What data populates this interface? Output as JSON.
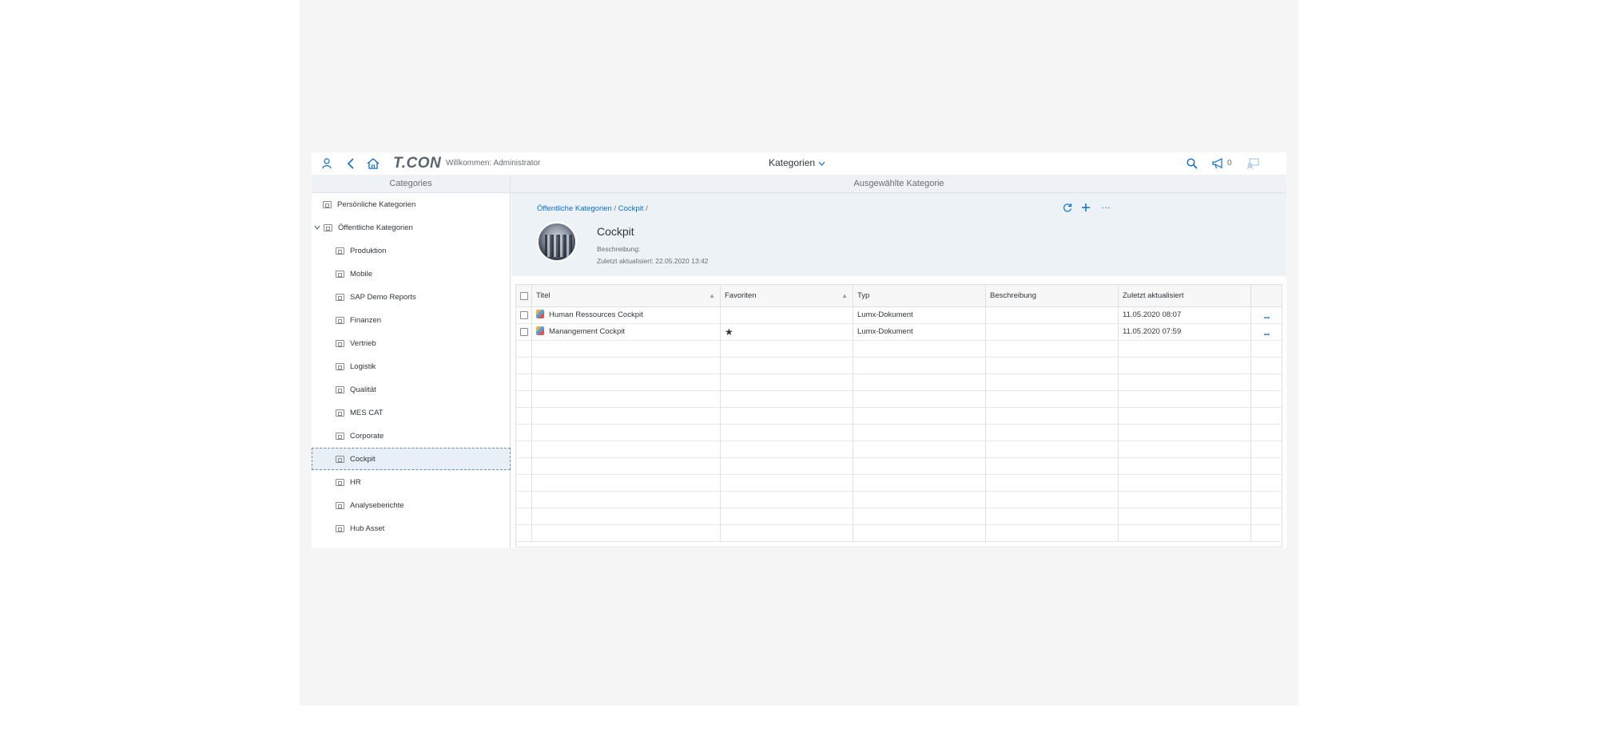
{
  "shell": {
    "logo": "T.CON",
    "welcome": "Willkommen: Administrator",
    "center_title": "Kategorien",
    "notification_count": "0",
    "icons": [
      "user-icon",
      "back-icon",
      "home-icon",
      "search-icon",
      "megaphone-icon",
      "help-icon"
    ]
  },
  "left_panel": {
    "header": "Categories",
    "items": [
      {
        "label": "Persönliche Kategorien",
        "level": 0
      },
      {
        "label": "Öffentliche Kategorien",
        "level": 0,
        "expanded": true
      },
      {
        "label": "Produktion",
        "level": 1
      },
      {
        "label": "Mobile",
        "level": 1
      },
      {
        "label": "SAP Demo Reports",
        "level": 1
      },
      {
        "label": "Finanzen",
        "level": 1
      },
      {
        "label": "Vertrieb",
        "level": 1
      },
      {
        "label": "Logistik",
        "level": 1
      },
      {
        "label": "Qualität",
        "level": 1
      },
      {
        "label": "MES CAT",
        "level": 1
      },
      {
        "label": "Corporate",
        "level": 1
      },
      {
        "label": "Cockpit",
        "level": 1,
        "selected": true
      },
      {
        "label": "HR",
        "level": 1
      },
      {
        "label": "Analyseberichte",
        "level": 1
      },
      {
        "label": "Hub Asset",
        "level": 1
      }
    ]
  },
  "right_panel": {
    "header": "Ausgewählte Kategorie",
    "breadcrumb": [
      "Öffentliche Kategorien",
      "Cockpit"
    ],
    "title": "Cockpit",
    "description_label": "Beschreibung:",
    "updated_label": "Zuletzt aktualisiert: 22.05.2020 13:42",
    "actions": [
      "refresh-icon",
      "add-icon",
      "more-icon"
    ]
  },
  "table": {
    "columns": [
      "Titel",
      "Favoriten",
      "Typ",
      "Beschreibung",
      "Zuletzt aktualisiert"
    ],
    "rows": [
      {
        "title": "Human Ressources Cockpit",
        "favorite": "",
        "type": "Lumx-Dokument",
        "description": "",
        "updated": "11.05.2020 08:07",
        "more": "..."
      },
      {
        "title": "Manangement Cockpit",
        "favorite": "★",
        "type": "Lumx-Dokument",
        "description": "",
        "updated": "11.05.2020 07:59",
        "more": "..."
      }
    ],
    "empty_rows": 12
  },
  "colors": {
    "accent": "#0a6ed1",
    "header_bg": "#eef2f6",
    "selected_bg": "#e8eff7"
  }
}
